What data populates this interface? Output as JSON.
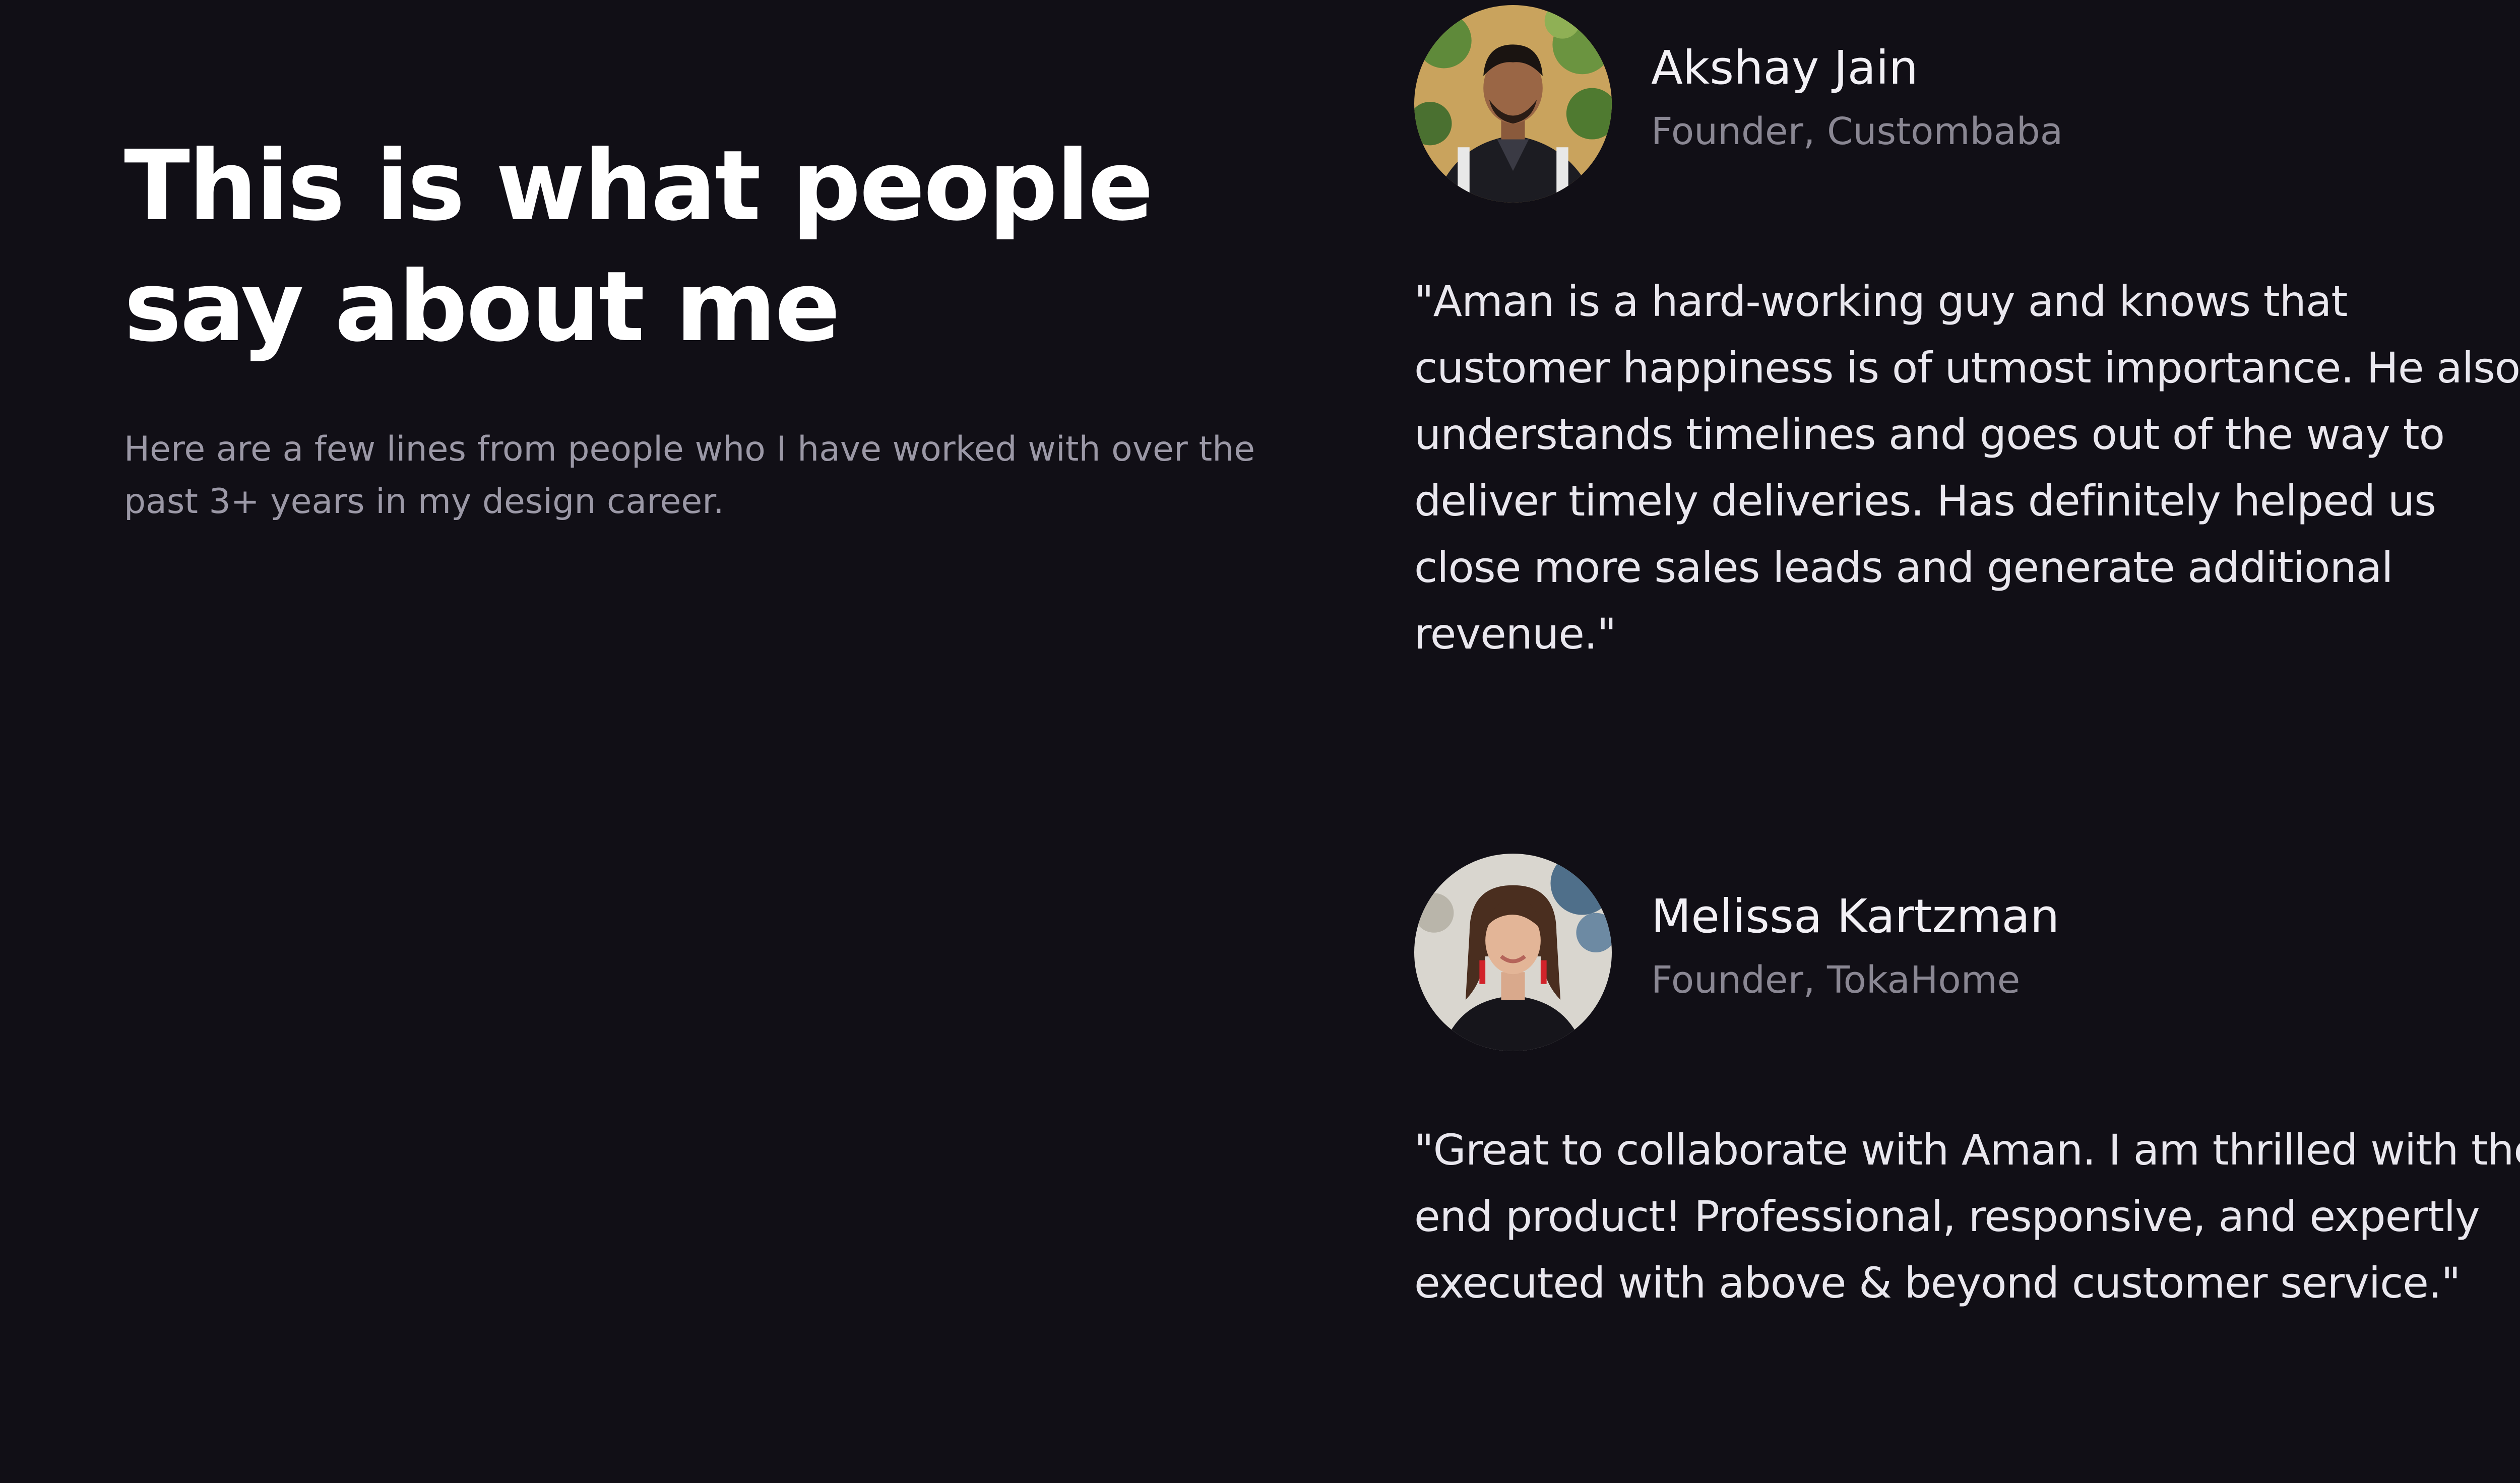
{
  "intro": {
    "heading_line1": "This is what people",
    "heading_line2": "say about me",
    "subtext": "Here are a few lines from people who I have worked with over the past 3+ years in my design career."
  },
  "testimonials": [
    {
      "name": "Akshay Jain",
      "role": "Founder, Custombaba",
      "quote": "\"Aman is a hard-working guy and knows that customer happiness is of utmost importance. He also understands timelines and goes out of the way to deliver timely deliveries. Has definitely helped us close more sales leads and generate additional revenue.\""
    },
    {
      "name": "Melissa Kartzman",
      "role": "Founder, TokaHome",
      "quote": "\"Great to collaborate with Aman. I am thrilled with the end product! Professional, responsive, and expertly executed with above & beyond customer service.\""
    }
  ],
  "colors": {
    "background": "#110f16",
    "heading": "#ffffff",
    "body_text": "#e9e7ee",
    "muted_text": "#9b98a6"
  }
}
